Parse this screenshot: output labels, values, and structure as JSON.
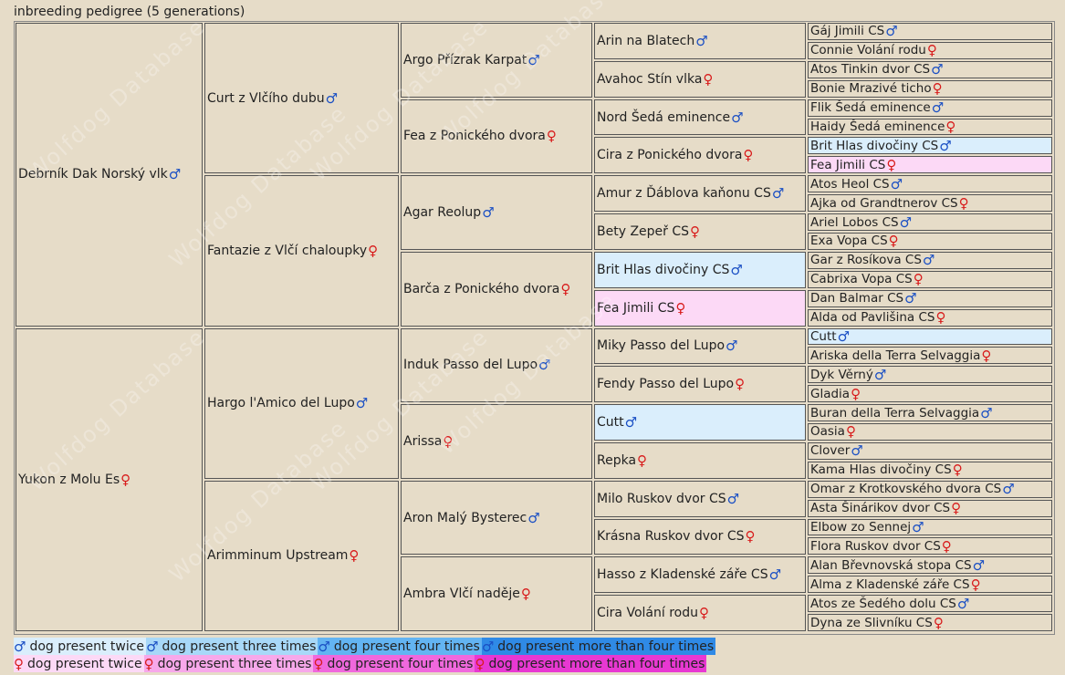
{
  "title": "inbreeding pedigree (5 generations)",
  "colors": {
    "male": "#1a4fc4",
    "female": "#d81b1b",
    "background": "#e6dcc8",
    "highlight_male_twice": "#daeefc",
    "highlight_female_twice": "#fcd9f6",
    "male_twice": "#daeefc",
    "male_three": "#a8d8f8",
    "male_four": "#63b4f2",
    "male_more": "#2f8ae6",
    "female_twice": "#fcd9f6",
    "female_three": "#f7a8ea",
    "female_four": "#f068dd",
    "female_more": "#e838d2"
  },
  "symbols": {
    "male": "♂",
    "female": "♀"
  },
  "watermark": "Wolfdog Database",
  "pedigree": {
    "gen1": [
      {
        "name": "Debrník Dak Norský vlk",
        "sex": "male"
      },
      {
        "name": "Yukon z Molu Es",
        "sex": "female"
      }
    ],
    "gen2": [
      {
        "name": "Curt z Vlčího dubu",
        "sex": "male"
      },
      {
        "name": "Fantazie z Vlčí chaloupky",
        "sex": "female"
      },
      {
        "name": "Hargo l'Amico del Lupo",
        "sex": "male"
      },
      {
        "name": "Arimminum Upstream",
        "sex": "female"
      }
    ],
    "gen3": [
      {
        "name": "Argo Přízrak Karpat",
        "sex": "male"
      },
      {
        "name": "Fea z Ponického dvora",
        "sex": "female"
      },
      {
        "name": "Agar Reolup",
        "sex": "male"
      },
      {
        "name": "Barča z Ponického dvora",
        "sex": "female"
      },
      {
        "name": "Induk Passo del Lupo",
        "sex": "male"
      },
      {
        "name": "Arissa",
        "sex": "female"
      },
      {
        "name": "Aron Malý Bysterec",
        "sex": "male"
      },
      {
        "name": "Ambra Vlčí naděje",
        "sex": "female"
      }
    ],
    "gen4": [
      {
        "name": "Arin na Blatech",
        "sex": "male"
      },
      {
        "name": "Avahoc Stín vlka",
        "sex": "female"
      },
      {
        "name": "Nord Šedá eminence",
        "sex": "male"
      },
      {
        "name": "Cira z Ponického dvora",
        "sex": "female"
      },
      {
        "name": "Amur z Ďáblova kaňonu CS",
        "sex": "male"
      },
      {
        "name": "Bety Zepeř CS",
        "sex": "female"
      },
      {
        "name": "Brit Hlas divočiny CS",
        "sex": "male",
        "highlight": "male_twice"
      },
      {
        "name": "Fea Jimili CS",
        "sex": "female",
        "highlight": "female_twice"
      },
      {
        "name": "Miky Passo del Lupo",
        "sex": "male"
      },
      {
        "name": "Fendy Passo del Lupo",
        "sex": "female"
      },
      {
        "name": "Cutt",
        "sex": "male",
        "highlight": "male_twice"
      },
      {
        "name": "Repka",
        "sex": "female"
      },
      {
        "name": "Milo Ruskov dvor CS",
        "sex": "male"
      },
      {
        "name": "Krásna Ruskov dvor CS",
        "sex": "female"
      },
      {
        "name": "Hasso z Kladenské záře CS",
        "sex": "male"
      },
      {
        "name": "Cira Volání rodu",
        "sex": "female"
      }
    ],
    "gen5": [
      {
        "name": "Gáj Jimili CS",
        "sex": "male"
      },
      {
        "name": "Connie Volání rodu",
        "sex": "female"
      },
      {
        "name": "Atos Tinkin dvor CS",
        "sex": "male"
      },
      {
        "name": "Bonie Mrazivé ticho",
        "sex": "female"
      },
      {
        "name": "Flik Šedá eminence",
        "sex": "male"
      },
      {
        "name": "Haidy Šedá eminence",
        "sex": "female"
      },
      {
        "name": "Brit Hlas divočiny CS",
        "sex": "male",
        "highlight": "male_twice"
      },
      {
        "name": "Fea Jimili CS",
        "sex": "female",
        "highlight": "female_twice"
      },
      {
        "name": "Atos Heol CS",
        "sex": "male"
      },
      {
        "name": "Ajka od Grandtnerov CS",
        "sex": "female"
      },
      {
        "name": "Ariel Lobos CS",
        "sex": "male"
      },
      {
        "name": "Exa Vopa CS",
        "sex": "female"
      },
      {
        "name": "Gar z Rosíkova CS",
        "sex": "male"
      },
      {
        "name": "Cabrixa Vopa CS",
        "sex": "female"
      },
      {
        "name": "Dan Balmar CS",
        "sex": "male"
      },
      {
        "name": "Alda od Pavlišina CS",
        "sex": "female"
      },
      {
        "name": "Cutt",
        "sex": "male",
        "highlight": "male_twice"
      },
      {
        "name": "Ariska della Terra Selvaggia",
        "sex": "female"
      },
      {
        "name": "Dyk Věrný",
        "sex": "male"
      },
      {
        "name": "Gladia",
        "sex": "female"
      },
      {
        "name": "Buran della Terra Selvaggia",
        "sex": "male"
      },
      {
        "name": "Oasia",
        "sex": "female"
      },
      {
        "name": "Clover",
        "sex": "male"
      },
      {
        "name": "Kama Hlas divočiny CS",
        "sex": "female"
      },
      {
        "name": "Omar z Krotkovského dvora CS",
        "sex": "male"
      },
      {
        "name": "Asta Šinárikov dvor CS",
        "sex": "female"
      },
      {
        "name": "Elbow zo Sennej",
        "sex": "male"
      },
      {
        "name": "Flora Ruskov dvor CS",
        "sex": "female"
      },
      {
        "name": "Alan Břevnovská stopa CS",
        "sex": "male"
      },
      {
        "name": "Alma z Kladenské záře CS",
        "sex": "female"
      },
      {
        "name": "Atos ze Šedého dolu CS",
        "sex": "male"
      },
      {
        "name": "Dyna ze Slivníku CS",
        "sex": "female"
      }
    ]
  },
  "legend": {
    "male": [
      {
        "label": "dog present twice",
        "color_key": "male_twice"
      },
      {
        "label": "dog present three times",
        "color_key": "male_three"
      },
      {
        "label": "dog present four times",
        "color_key": "male_four"
      },
      {
        "label": "dog present more than four times",
        "color_key": "male_more"
      }
    ],
    "female": [
      {
        "label": "dog present twice",
        "color_key": "female_twice"
      },
      {
        "label": "dog present three times",
        "color_key": "female_three"
      },
      {
        "label": "dog present four times",
        "color_key": "female_four"
      },
      {
        "label": "dog present more than four times",
        "color_key": "female_more"
      }
    ]
  }
}
